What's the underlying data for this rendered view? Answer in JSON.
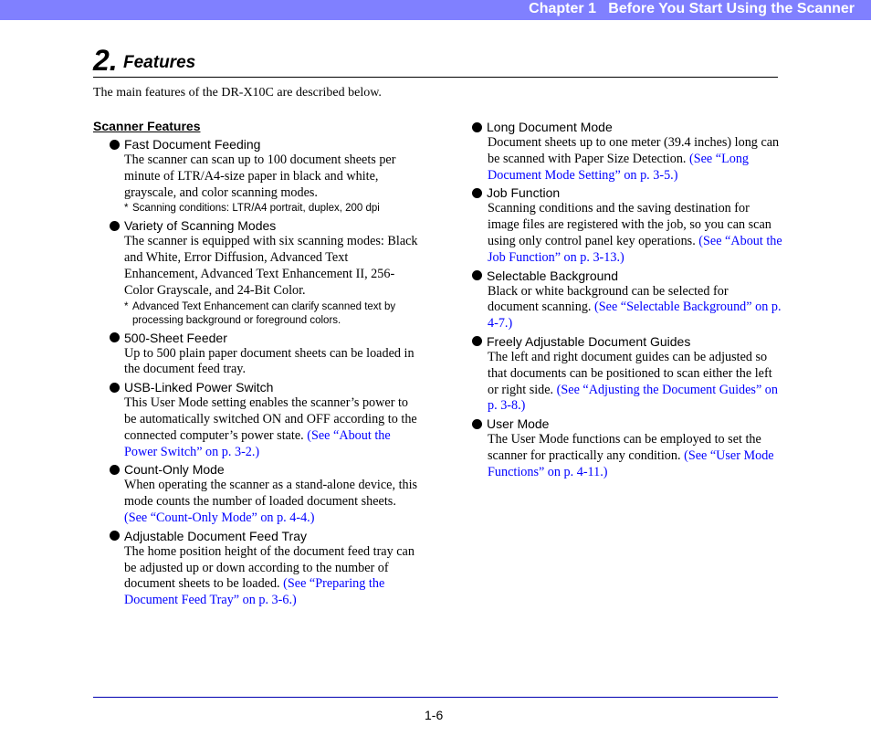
{
  "header": {
    "chapter": "Chapter 1   Before You Start Using the Scanner",
    "color": "#8080ff"
  },
  "heading": {
    "number": "2.",
    "title": "Features"
  },
  "intro": "The main features of the DR-X10C are described below.",
  "section_title": "Scanner Features",
  "left_features": [
    {
      "title": "Fast Document Feeding",
      "body": "The scanner can scan up to 100 document sheets per minute of LTR/A4-size paper in black and white, grayscale, and color scanning modes.",
      "link": "",
      "note": "Scanning conditions: LTR/A4 portrait, duplex, 200 dpi"
    },
    {
      "title": "Variety of Scanning Modes",
      "body": "The scanner is equipped with six scanning modes: Black and White, Error Diffusion, Advanced Text Enhancement, Advanced Text Enhancement II, 256-Color Grayscale, and 24-Bit Color.",
      "link": "",
      "note": "Advanced Text Enhancement can clarify scanned text by processing background or foreground colors."
    },
    {
      "title": "500-Sheet Feeder",
      "body": "Up to 500 plain paper document sheets can be loaded in the document feed tray.",
      "link": "",
      "note": ""
    },
    {
      "title": "USB-Linked Power Switch",
      "body": "This User Mode setting enables the scanner’s power to be automatically switched ON and OFF according to the connected computer’s power state. ",
      "link": "(See “About the Power Switch” on p. 3-2.)",
      "note": ""
    },
    {
      "title": "Count-Only Mode",
      "body": "When operating the scanner as a stand-alone device, this mode counts the number of loaded document sheets. ",
      "link": "(See “Count-Only Mode” on p. 4-4.)",
      "note": ""
    },
    {
      "title": "Adjustable Document Feed Tray",
      "body": "The home position height of the document feed tray can be adjusted up or down according to the number of document sheets to be loaded. ",
      "link": "(See “Preparing the Document Feed Tray” on p. 3-6.)",
      "note": ""
    }
  ],
  "right_features": [
    {
      "title": "Long Document Mode",
      "body": "Document sheets up to one meter (39.4 inches) long can be scanned with Paper Size Detection. ",
      "link": "(See “Long Document Mode Setting” on p. 3-5.)"
    },
    {
      "title": "Job Function",
      "body": "Scanning conditions and the saving destination for image files are registered with the job, so you can scan using only control panel key operations. ",
      "link": "(See “About the Job Function” on p. 3-13.)"
    },
    {
      "title": "Selectable Background",
      "body": "Black or white background can be selected for document scanning. ",
      "link": "(See “Selectable Background” on p. 4-7.)"
    },
    {
      "title": "Freely Adjustable Document Guides",
      "body": "The left and right document guides can be adjusted so that documents can be positioned to scan either the left or right side. ",
      "link": "(See “Adjusting the Document Guides” on p. 3-8.)"
    },
    {
      "title": "User Mode",
      "body": "The User Mode functions can be employed to set the scanner for practically any condition. ",
      "link": "(See “User Mode Functions” on p. 4-11.)"
    }
  ],
  "note_marker": "*",
  "footer": {
    "page": "1-6"
  }
}
